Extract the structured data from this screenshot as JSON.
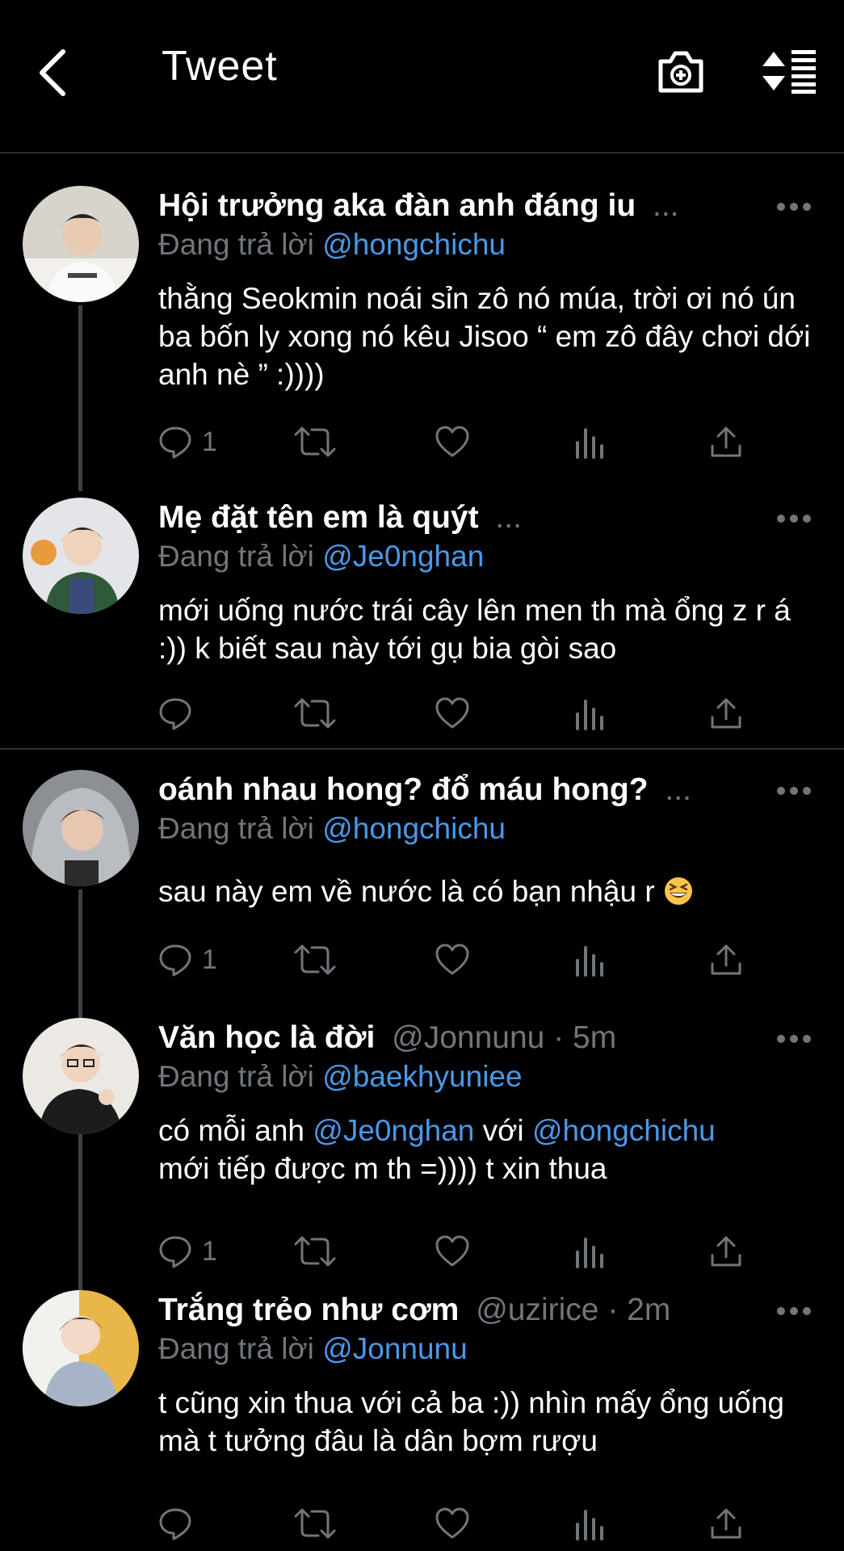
{
  "header": {
    "title": "Tweet"
  },
  "tweets": [
    {
      "name": "Hội trưởng aka đàn anh đáng iu",
      "handle_meta": "...",
      "reply_prefix": "Đang trả lời",
      "reply_to": "@hongchichu",
      "body": "thằng Seokmin noái sỉn zô nó múa, trời ơi nó ún ba bốn ly xong nó kêu Jisoo “ em zô đây chơi dới anh nè ” :))))",
      "reply_count": "1"
    },
    {
      "name": "Mẹ đặt tên em là quýt",
      "handle_meta": "...",
      "reply_prefix": "Đang trả lời",
      "reply_to": "@Je0nghan",
      "body": "mới uống nước trái cây lên men th mà ổng z r á :)) k biết sau này tới gụ bia gòi sao",
      "reply_count": ""
    },
    {
      "name": "oánh nhau hong? đổ máu hong?",
      "handle_meta": "...",
      "reply_prefix": "Đang trả lời",
      "reply_to": "@hongchichu",
      "body": "sau này em về nước là có bạn nhậu r",
      "emoji": "grinning-squinting-face",
      "reply_count": "1"
    },
    {
      "name": "Văn học là đời",
      "handle_meta": "@Jonnunu · 5m",
      "reply_prefix": "Đang trả lời",
      "reply_to": "@baekhyuniee",
      "body_parts": {
        "p1": "có mỗi anh ",
        "m1": "@Je0nghan",
        "p2": " với ",
        "m2": "@hongchichu",
        "p3": "mới tiếp được m th =)))) t xin thua"
      },
      "reply_count": "1"
    },
    {
      "name": "Trắng trẻo như cơm",
      "handle_meta": "@uzirice · 2m",
      "reply_prefix": "Đang trả lời",
      "reply_to": "@Jonnunu",
      "body": "t cũng xin thua với cả ba :)) nhìn mấy ổng uống mà t tưởng đâu là dân bợm rượu",
      "reply_count": ""
    }
  ],
  "colors": {
    "background": "#000000",
    "text": "#ffffff",
    "muted": "#71767b",
    "mention": "#4a99e9",
    "divider": "#2f3336"
  },
  "icons": [
    "back-arrow-icon",
    "camera-plus-icon",
    "sort-list-icon",
    "more-dots-icon",
    "reply-icon",
    "retweet-icon",
    "like-icon",
    "views-icon",
    "share-icon"
  ]
}
